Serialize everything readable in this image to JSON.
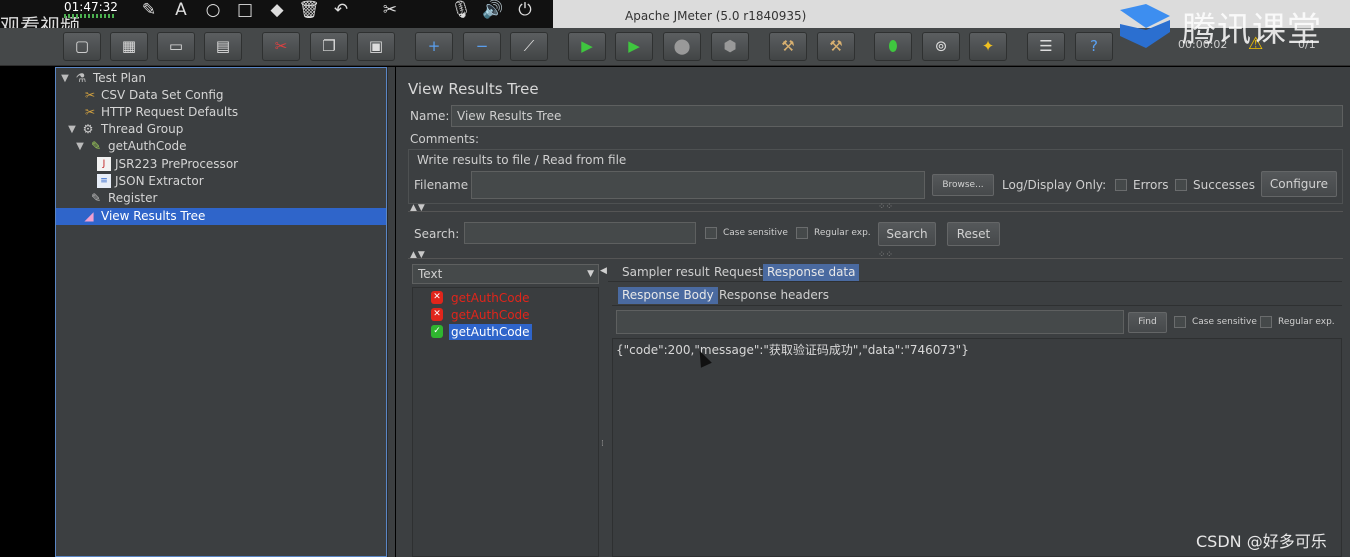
{
  "recorder": {
    "time": "01:47:32",
    "watch_text": "观看视频",
    "tools": [
      "brush-icon",
      "text-icon",
      "circle-icon",
      "square-icon",
      "eraser-icon",
      "trash-icon",
      "undo-icon",
      "tools-icon",
      "mic-icon",
      "volume-icon",
      "power-icon"
    ]
  },
  "window": {
    "title": "Apache JMeter (5.0 r1840935)"
  },
  "toolbar": {
    "timer": "00:00:02",
    "count": "0/1",
    "buttons": [
      "new-icon",
      "templates-icon",
      "open-icon",
      "save-icon",
      "cut-icon",
      "copy-icon",
      "paste-icon",
      "expand-icon",
      "collapse-icon",
      "toggle-icon",
      "start-icon",
      "start-no-pause-icon",
      "stop-icon",
      "shutdown-icon",
      "remote-start-icon",
      "remote-stop-icon",
      "remote-shutdown-icon",
      "search-icon",
      "clear-all-icon",
      "function-helper-icon",
      "help-icon"
    ]
  },
  "watermark": {
    "brand": "腾讯课堂",
    "footer": "CSDN @好多可乐"
  },
  "tree": {
    "items": [
      {
        "label": "Test Plan",
        "icon": "test-plan-icon",
        "depth": 0,
        "expanded": true
      },
      {
        "label": "CSV Data Set Config",
        "icon": "config-icon",
        "depth": 1
      },
      {
        "label": "HTTP Request Defaults",
        "icon": "config-icon",
        "depth": 1
      },
      {
        "label": "Thread Group",
        "icon": "gear-icon",
        "depth": 1,
        "expanded": true
      },
      {
        "label": "getAuthCode",
        "icon": "sampler-icon",
        "depth": 2,
        "expanded": true
      },
      {
        "label": "JSR223 PreProcessor",
        "icon": "script-icon",
        "depth": 3
      },
      {
        "label": "JSON Extractor",
        "icon": "extractor-icon",
        "depth": 3
      },
      {
        "label": "Register",
        "icon": "sampler-icon",
        "depth": 2
      },
      {
        "label": "View Results Tree",
        "icon": "listener-icon",
        "depth": 1,
        "selected": true
      }
    ]
  },
  "panel": {
    "title": "View Results Tree",
    "name_label": "Name:",
    "name_value": "View Results Tree",
    "comments_label": "Comments:",
    "write_section": "Write results to file / Read from file",
    "filename_label": "Filename",
    "filename_value": "",
    "browse_label": "Browse...",
    "log_display_label": "Log/Display Only:",
    "errors_label": "Errors",
    "successes_label": "Successes",
    "configure_label": "Configure",
    "search_label": "Search:",
    "search_value": "",
    "case_sensitive_label": "Case sensitive",
    "regex_label": "Regular exp.",
    "search_button": "Search",
    "reset_button": "Reset",
    "renderer": "Text"
  },
  "results": [
    {
      "label": "getAuthCode",
      "status": "error"
    },
    {
      "label": "getAuthCode",
      "status": "error"
    },
    {
      "label": "getAuthCode",
      "status": "success",
      "selected": true
    }
  ],
  "result_tabs": [
    "Sampler result",
    "Request",
    "Response data"
  ],
  "active_result_tab": "Response data",
  "response_subtabs": [
    "Response Body",
    "Response headers"
  ],
  "active_response_subtab": "Response Body",
  "find": {
    "value": "",
    "find_button": "Find",
    "case_sensitive_label": "Case sensitive",
    "regex_label": "Regular exp."
  },
  "response_body": "{\"code\":200,\"message\":\"获取验证码成功\",\"data\":\"746073\"}",
  "colors": {
    "error": "#e0251b",
    "success": "#2fb52f",
    "selection": "#2f65ca",
    "background": "#3c3f41"
  }
}
